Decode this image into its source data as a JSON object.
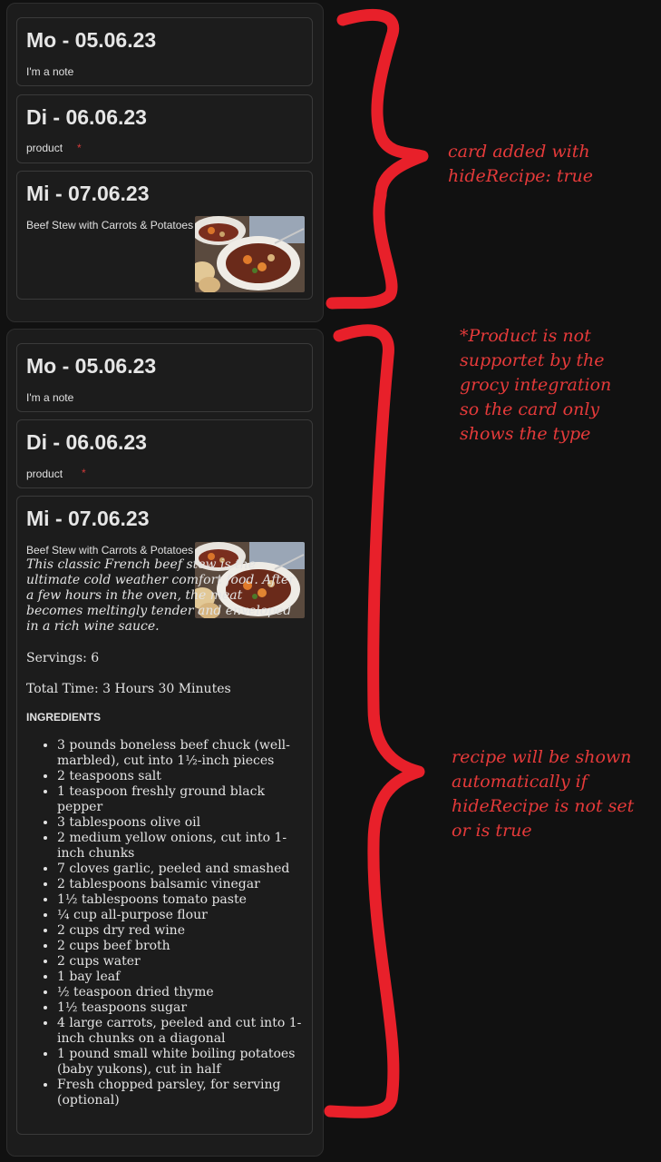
{
  "top_card": {
    "days": [
      {
        "title": "Mo - 05.06.23",
        "entry": "I'm a note"
      },
      {
        "title": "Di - 06.06.23",
        "entry": "product",
        "marker": "*"
      },
      {
        "title": "Mi - 07.06.23",
        "entry": "Beef Stew with Carrots & Potatoes"
      }
    ]
  },
  "bottom_card": {
    "days": [
      {
        "title": "Mo - 05.06.23",
        "entry": "I'm a note"
      },
      {
        "title": "Di - 06.06.23",
        "entry": "product",
        "marker": "*"
      },
      {
        "title": "Mi - 07.06.23",
        "entry": "Beef Stew with Carrots & Potatoes"
      }
    ],
    "recipe": {
      "description": "This classic French beef stew is the ultimate cold weather comfort food. After a few hours in the oven, the meat becomes meltingly tender and enveloped in a rich wine sauce.",
      "servings": "Servings: 6",
      "total_time": "Total Time: 3 Hours 30 Minutes",
      "ingredients_heading": "INGREDIENTS",
      "ingredients": [
        "3 pounds boneless beef chuck (well-marbled), cut into 1½-inch pieces",
        "2 teaspoons salt",
        "1 teaspoon freshly ground black pepper",
        "3 tablespoons olive oil",
        "2 medium yellow onions, cut into 1-inch chunks",
        "7 cloves garlic, peeled and smashed",
        "2 tablespoons balsamic vinegar",
        "1½ tablespoons tomato paste",
        "¼ cup all-purpose flour",
        "2 cups dry red wine",
        "2 cups beef broth",
        "2 cups water",
        "1 bay leaf",
        "½ teaspoon dried thyme",
        "1½ teaspoons sugar",
        "4 large carrots, peeled and cut into 1-inch chunks on a diagonal",
        "1 pound small white boiling potatoes (baby yukons), cut in half",
        "Fresh chopped parsley, for serving (optional)"
      ]
    }
  },
  "annotations": {
    "top": [
      "card added with",
      "hideRecipe: true"
    ],
    "middle": [
      "*Product is not",
      "supportet by the",
      "grocy integration",
      "so the card only",
      "shows the type"
    ],
    "bottom": [
      "recipe will be shown",
      "automatically if",
      "hideRecipe is not set",
      "or is true"
    ]
  },
  "colors": {
    "annotation": "#e53a3a",
    "brace": "#e8202a",
    "card_bg": "#1c1c1c",
    "page_bg": "#111111"
  }
}
